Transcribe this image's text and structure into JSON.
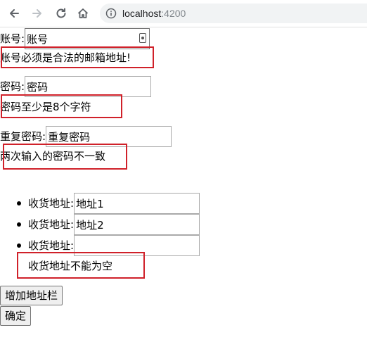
{
  "browser": {
    "url_host": "localhost",
    "url_port": ":4200"
  },
  "form": {
    "account": {
      "label": "账号:",
      "value": "账号",
      "error": "账号必须是合法的邮箱地址!"
    },
    "password": {
      "label": "密码:",
      "value": "密码",
      "error": "密码至少是8个字符"
    },
    "confirm_password": {
      "label": "重复密码:",
      "value": "重复密码",
      "error": "两次输入的密码不一致"
    },
    "addresses": {
      "items": [
        {
          "label": "收货地址:",
          "value": "地址1"
        },
        {
          "label": "收货地址:",
          "value": "地址2"
        },
        {
          "label": "收货地址:",
          "value": ""
        }
      ],
      "error": "收货地址不能为空"
    },
    "add_address_button": "增加地址栏",
    "submit_button": "确定"
  },
  "colors": {
    "error_box": "#d0212a"
  }
}
